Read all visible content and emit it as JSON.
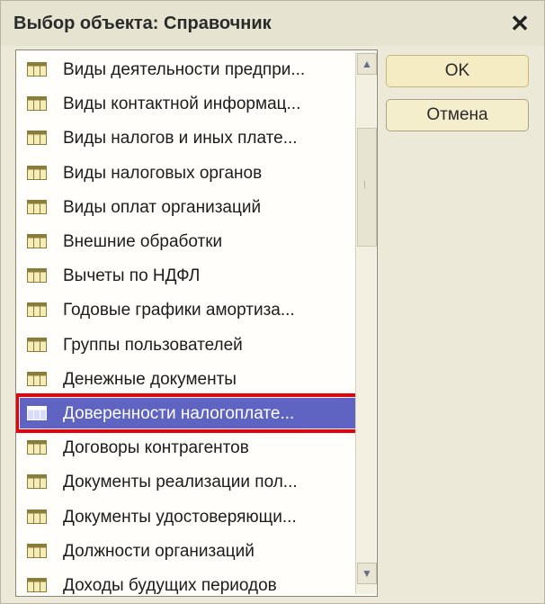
{
  "window": {
    "title": "Выбор объекта: Справочник",
    "close_glyph": "✕"
  },
  "list": {
    "items": [
      {
        "label": "Виды деятельности предпри..."
      },
      {
        "label": "Виды контактной информац..."
      },
      {
        "label": "Виды налогов и иных плате..."
      },
      {
        "label": "Виды налоговых органов"
      },
      {
        "label": "Виды оплат организаций"
      },
      {
        "label": "Внешние обработки"
      },
      {
        "label": "Вычеты по НДФЛ"
      },
      {
        "label": "Годовые графики амортиза..."
      },
      {
        "label": "Группы пользователей"
      },
      {
        "label": "Денежные документы"
      },
      {
        "label": "Доверенности налогоплате..."
      },
      {
        "label": "Договоры контрагентов"
      },
      {
        "label": "Документы реализации пол..."
      },
      {
        "label": "Документы удостоверяющи..."
      },
      {
        "label": "Должности организаций"
      },
      {
        "label": "Доходы будущих периодов"
      }
    ],
    "selected_index": 10,
    "item_icon": "catalog-table-icon"
  },
  "buttons": {
    "ok_label": "OK",
    "cancel_label": "Отмена"
  },
  "scrollbar": {
    "up_glyph": "▲",
    "down_glyph": "▼"
  },
  "colors": {
    "selection": "#5f63c2",
    "highlight_border": "#e8000c",
    "window_bg": "#ece9d8"
  }
}
